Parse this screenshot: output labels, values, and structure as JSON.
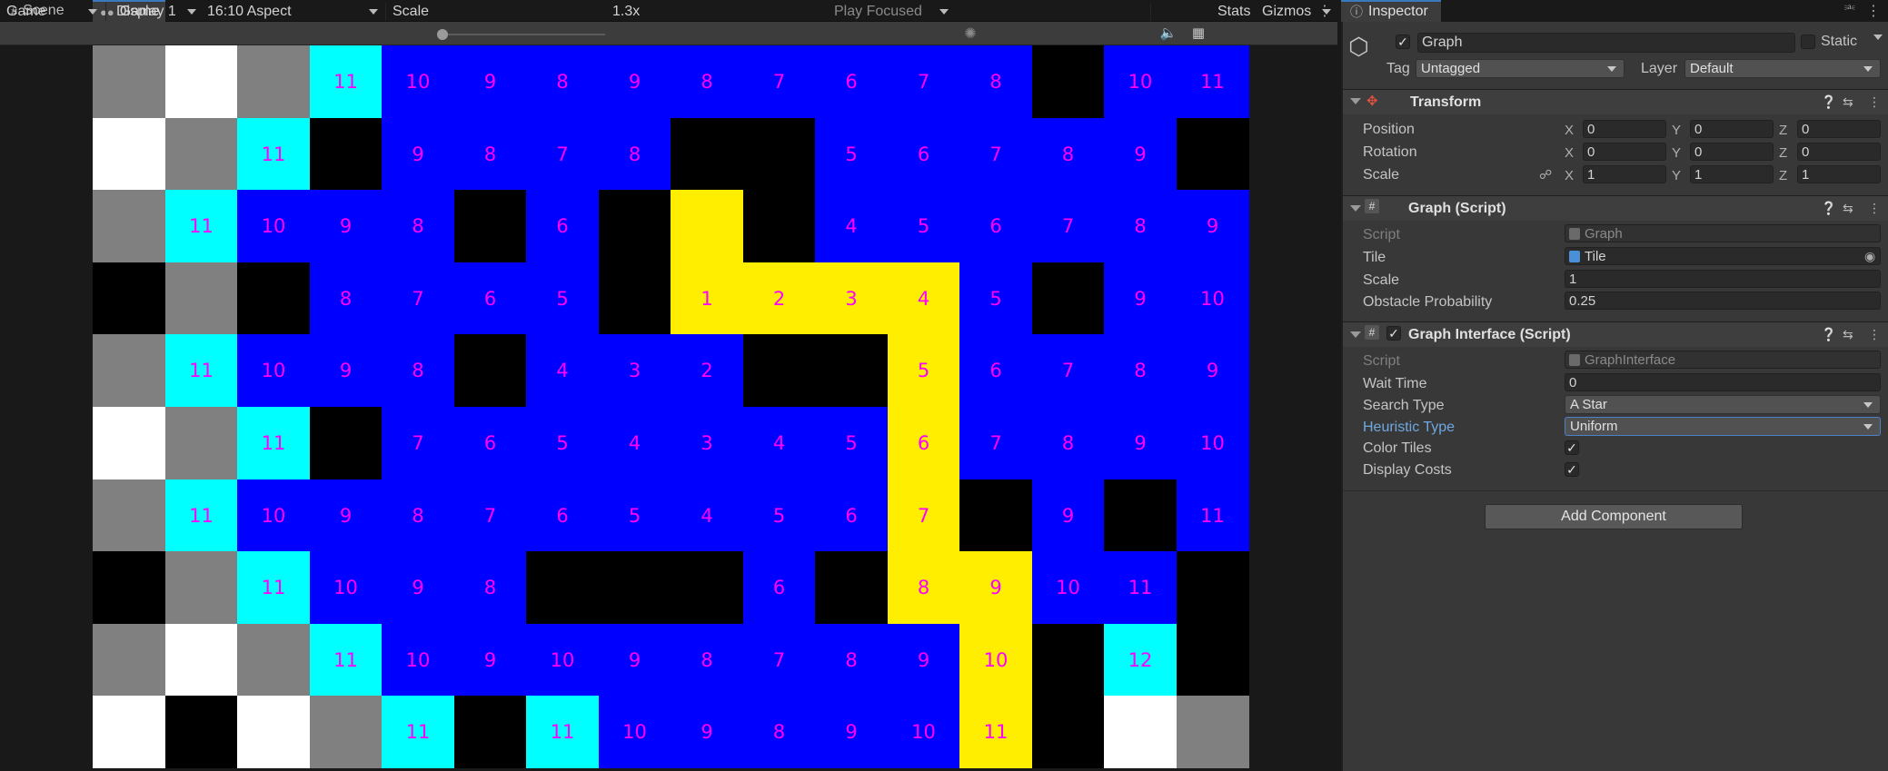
{
  "tabs": {
    "scene": "Scene",
    "game": "Game",
    "scene_icon": "grid-icon",
    "game_icon": "gamepad-icon"
  },
  "toolbar": {
    "mode": "Game",
    "display": "Display 1",
    "aspect": "16:10 Aspect",
    "scale_label": "Scale",
    "scale_value": "1.3x",
    "play_mode": "Play Focused",
    "stats": "Stats",
    "gizmos": "Gizmos"
  },
  "grid": {
    "colors": {
      "open": "#0000ff",
      "wall": "#000000",
      "path": "#ffee00",
      "frontier": "#00ffff",
      "gray": "#808080",
      "white": "#ffffff",
      "cost_text": "#ff00ff"
    },
    "rows": [
      [
        [
          "G",
          ""
        ],
        [
          "W",
          ""
        ],
        [
          "G",
          ""
        ],
        [
          "C",
          "11"
        ],
        [
          "B",
          "10"
        ],
        [
          "B",
          "9"
        ],
        [
          "B",
          "8"
        ],
        [
          "B",
          "9"
        ],
        [
          "B",
          "8"
        ],
        [
          "B",
          "7"
        ],
        [
          "B",
          "6"
        ],
        [
          "B",
          "7"
        ],
        [
          "B",
          "8"
        ],
        [
          "K",
          ""
        ],
        [
          "B",
          "10"
        ],
        [
          "B",
          "11"
        ]
      ],
      [
        [
          "W",
          ""
        ],
        [
          "G",
          ""
        ],
        [
          "C",
          "11"
        ],
        [
          "K",
          ""
        ],
        [
          "B",
          "9"
        ],
        [
          "B",
          "8"
        ],
        [
          "B",
          "7"
        ],
        [
          "B",
          "8"
        ],
        [
          "K",
          ""
        ],
        [
          "K",
          ""
        ],
        [
          "B",
          "5"
        ],
        [
          "B",
          "6"
        ],
        [
          "B",
          "7"
        ],
        [
          "B",
          "8"
        ],
        [
          "B",
          "9"
        ],
        [
          "K",
          ""
        ]
      ],
      [
        [
          "G",
          ""
        ],
        [
          "C",
          "11"
        ],
        [
          "B",
          "10"
        ],
        [
          "B",
          "9"
        ],
        [
          "B",
          "8"
        ],
        [
          "K",
          ""
        ],
        [
          "B",
          "6"
        ],
        [
          "K",
          ""
        ],
        [
          "Y",
          ""
        ],
        [
          "K",
          ""
        ],
        [
          "B",
          "4"
        ],
        [
          "B",
          "5"
        ],
        [
          "B",
          "6"
        ],
        [
          "B",
          "7"
        ],
        [
          "B",
          "8"
        ],
        [
          "B",
          "9"
        ]
      ],
      [
        [
          "K",
          ""
        ],
        [
          "G",
          ""
        ],
        [
          "K",
          ""
        ],
        [
          "B",
          "8"
        ],
        [
          "B",
          "7"
        ],
        [
          "B",
          "6"
        ],
        [
          "B",
          "5"
        ],
        [
          "K",
          ""
        ],
        [
          "Y",
          "1"
        ],
        [
          "Y",
          "2"
        ],
        [
          "Y",
          "3"
        ],
        [
          "Y",
          "4"
        ],
        [
          "B",
          "5"
        ],
        [
          "K",
          ""
        ],
        [
          "B",
          "9"
        ],
        [
          "B",
          "10"
        ]
      ],
      [
        [
          "G",
          ""
        ],
        [
          "C",
          "11"
        ],
        [
          "B",
          "10"
        ],
        [
          "B",
          "9"
        ],
        [
          "B",
          "8"
        ],
        [
          "K",
          ""
        ],
        [
          "B",
          "4"
        ],
        [
          "B",
          "3"
        ],
        [
          "B",
          "2"
        ],
        [
          "K",
          ""
        ],
        [
          "K",
          ""
        ],
        [
          "Y",
          "5"
        ],
        [
          "B",
          "6"
        ],
        [
          "B",
          "7"
        ],
        [
          "B",
          "8"
        ],
        [
          "B",
          "9"
        ]
      ],
      [
        [
          "W",
          ""
        ],
        [
          "G",
          ""
        ],
        [
          "C",
          "11"
        ],
        [
          "K",
          ""
        ],
        [
          "B",
          "7"
        ],
        [
          "B",
          "6"
        ],
        [
          "B",
          "5"
        ],
        [
          "B",
          "4"
        ],
        [
          "B",
          "3"
        ],
        [
          "B",
          "4"
        ],
        [
          "B",
          "5"
        ],
        [
          "Y",
          "6"
        ],
        [
          "B",
          "7"
        ],
        [
          "B",
          "8"
        ],
        [
          "B",
          "9"
        ],
        [
          "B",
          "10"
        ]
      ],
      [
        [
          "G",
          ""
        ],
        [
          "C",
          "11"
        ],
        [
          "B",
          "10"
        ],
        [
          "B",
          "9"
        ],
        [
          "B",
          "8"
        ],
        [
          "B",
          "7"
        ],
        [
          "B",
          "6"
        ],
        [
          "B",
          "5"
        ],
        [
          "B",
          "4"
        ],
        [
          "B",
          "5"
        ],
        [
          "B",
          "6"
        ],
        [
          "Y",
          "7"
        ],
        [
          "K",
          ""
        ],
        [
          "B",
          "9"
        ],
        [
          "K",
          ""
        ],
        [
          "B",
          "11"
        ]
      ],
      [
        [
          "K",
          ""
        ],
        [
          "G",
          ""
        ],
        [
          "C",
          "11"
        ],
        [
          "B",
          "10"
        ],
        [
          "B",
          "9"
        ],
        [
          "B",
          "8"
        ],
        [
          "K",
          ""
        ],
        [
          "K",
          ""
        ],
        [
          "K",
          ""
        ],
        [
          "B",
          "6"
        ],
        [
          "K",
          ""
        ],
        [
          "Y",
          "8"
        ],
        [
          "Y",
          "9"
        ],
        [
          "B",
          "10"
        ],
        [
          "B",
          "11"
        ],
        [
          "K",
          ""
        ]
      ],
      [
        [
          "G",
          ""
        ],
        [
          "W",
          ""
        ],
        [
          "G",
          ""
        ],
        [
          "C",
          "11"
        ],
        [
          "B",
          "10"
        ],
        [
          "B",
          "9"
        ],
        [
          "B",
          "10"
        ],
        [
          "B",
          "9"
        ],
        [
          "B",
          "8"
        ],
        [
          "B",
          "7"
        ],
        [
          "B",
          "8"
        ],
        [
          "B",
          "9"
        ],
        [
          "Y",
          "10"
        ],
        [
          "K",
          ""
        ],
        [
          "C",
          "12"
        ],
        [
          "K",
          ""
        ]
      ],
      [
        [
          "W",
          ""
        ],
        [
          "K",
          ""
        ],
        [
          "W",
          ""
        ],
        [
          "G",
          ""
        ],
        [
          "C",
          "11"
        ],
        [
          "K",
          ""
        ],
        [
          "C",
          "11"
        ],
        [
          "B",
          "10"
        ],
        [
          "B",
          "9"
        ],
        [
          "B",
          "8"
        ],
        [
          "B",
          "9"
        ],
        [
          "B",
          "10"
        ],
        [
          "Y",
          "11"
        ],
        [
          "K",
          ""
        ],
        [
          "W",
          ""
        ],
        [
          "G",
          ""
        ]
      ]
    ]
  },
  "inspector": {
    "tab": "Inspector",
    "object_name": "Graph",
    "static_label": "Static",
    "tag_label": "Tag",
    "tag_value": "Untagged",
    "layer_label": "Layer",
    "layer_value": "Default",
    "transform": {
      "title": "Transform",
      "position_label": "Position",
      "rotation_label": "Rotation",
      "scale_label": "Scale",
      "position": {
        "x": "0",
        "y": "0",
        "z": "0"
      },
      "rotation": {
        "x": "0",
        "y": "0",
        "z": "0"
      },
      "scale": {
        "x": "1",
        "y": "1",
        "z": "1"
      },
      "axis_x": "X",
      "axis_y": "Y",
      "axis_z": "Z"
    },
    "graph_script": {
      "title": "Graph (Script)",
      "script_label": "Script",
      "script_value": "Graph",
      "tile_label": "Tile",
      "tile_value": "Tile",
      "scale_label": "Scale",
      "scale_value": "1",
      "obstacle_label": "Obstacle Probability",
      "obstacle_value": "0.25"
    },
    "graph_interface": {
      "title": "Graph Interface (Script)",
      "script_label": "Script",
      "script_value": "GraphInterface",
      "wait_label": "Wait Time",
      "wait_value": "0",
      "search_label": "Search Type",
      "search_value": "A Star",
      "heuristic_label": "Heuristic Type",
      "heuristic_value": "Uniform",
      "color_tiles_label": "Color Tiles",
      "color_tiles": true,
      "display_costs_label": "Display Costs",
      "display_costs": true
    },
    "add_component": "Add Component"
  }
}
